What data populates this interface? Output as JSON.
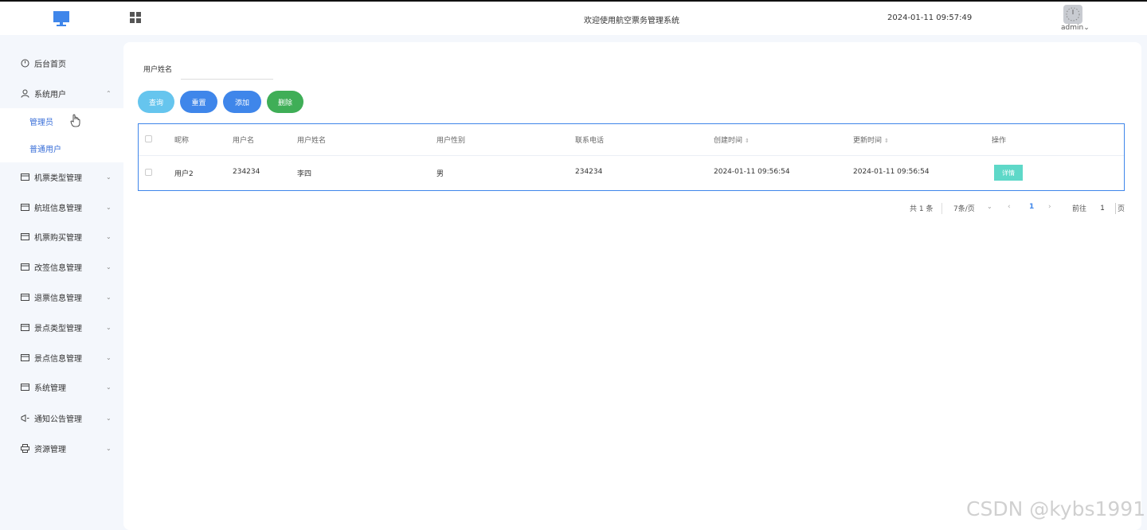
{
  "header": {
    "welcome_text": "欢迎使用航空票务管理系统",
    "datetime": "2024-01-11 09:57:49",
    "username": "admin",
    "username_caret": "⌄"
  },
  "sidebar": {
    "items": [
      {
        "label": "后台首页",
        "icon": "clock-icon"
      },
      {
        "label": "系统用户",
        "icon": "user-icon",
        "arrow": "⌃"
      },
      {
        "label": "机票类型管理",
        "icon": "folder-icon",
        "arrow": "⌄"
      },
      {
        "label": "航班信息管理",
        "icon": "folder-icon",
        "arrow": "⌄"
      },
      {
        "label": "机票购买管理",
        "icon": "folder-icon",
        "arrow": "⌄"
      },
      {
        "label": "改签信息管理",
        "icon": "folder-icon",
        "arrow": "⌄"
      },
      {
        "label": "退票信息管理",
        "icon": "folder-icon",
        "arrow": "⌄"
      },
      {
        "label": "景点类型管理",
        "icon": "folder-icon",
        "arrow": "⌄"
      },
      {
        "label": "景点信息管理",
        "icon": "folder-icon",
        "arrow": "⌄"
      },
      {
        "label": "系统管理",
        "icon": "folder-icon",
        "arrow": "⌄"
      },
      {
        "label": "通知公告管理",
        "icon": "megaphone-icon",
        "arrow": "⌄"
      },
      {
        "label": "资源管理",
        "icon": "printer-icon",
        "arrow": "⌄"
      }
    ],
    "submenu": [
      {
        "label": "管理员"
      },
      {
        "label": "普通用户"
      }
    ]
  },
  "search": {
    "label": "用户姓名",
    "value": "",
    "placeholder": ""
  },
  "buttons": {
    "query": "查询",
    "reset": "重置",
    "add": "添加",
    "delete": "删除"
  },
  "table": {
    "columns": [
      "昵称",
      "用户名",
      "用户姓名",
      "用户性别",
      "联系电话",
      "创建时间",
      "更新时间",
      "操作"
    ],
    "sort_icon": "⇕",
    "rows": [
      {
        "nickname": "用户2",
        "username": "234234",
        "realname": "李四",
        "gender": "男",
        "phone": "234234",
        "created": "2024-01-11 09:56:54",
        "updated": "2024-01-11 09:56:54",
        "action": "详情"
      }
    ]
  },
  "pagination": {
    "total": "共 1 条",
    "page_size": "7条/页",
    "size_caret": "⌄",
    "prev": "‹",
    "current_page": "1",
    "next": "›",
    "goto_label": "前往",
    "goto_value": "1",
    "page_unit": "页"
  },
  "watermark": "CSDN @kybs1991",
  "colors": {
    "primary": "#3f86ea",
    "query": "#66c5ee",
    "delete": "#3fae57",
    "detail": "#5ed8c8",
    "sidebar_bg": "#f4f7fc"
  }
}
